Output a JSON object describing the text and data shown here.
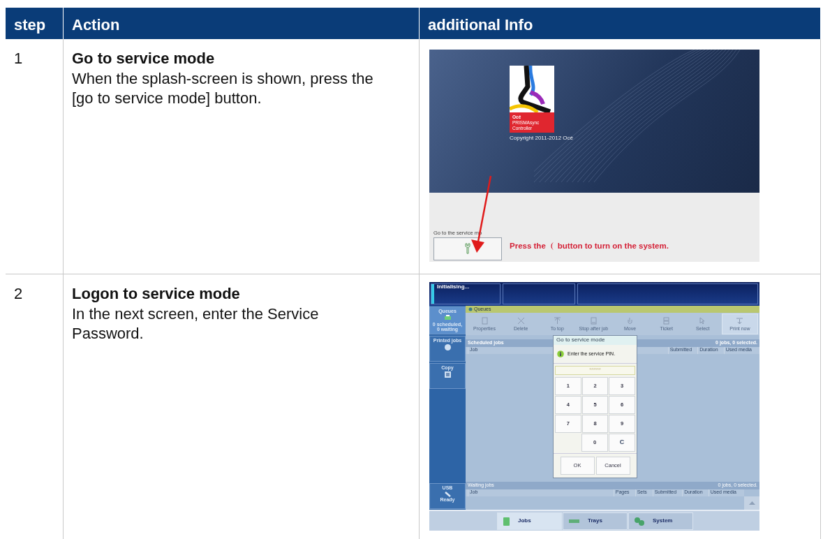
{
  "table": {
    "columns": [
      "step",
      "Action",
      "additional Info"
    ],
    "rows": [
      {
        "step": "1",
        "title": "Go to service mode",
        "text": "When the splash-screen is shown, press the [go to service mode] button.",
        "screenshot": {
          "kind": "splash",
          "logo_lines": [
            "Océ",
            "PRISMAsync",
            "Controller"
          ],
          "copyright": "Copyright 2011-2012 Océ",
          "service_label": "Go to the service mo",
          "message_before": "Press the",
          "message_after": "button to turn on the system."
        }
      },
      {
        "step": "2",
        "title": "Logon to service mode",
        "text": "In the next screen, enter the Service Password.",
        "screenshot": {
          "kind": "pin",
          "status": "Initialising...",
          "sidebar": [
            {
              "label": "Queues",
              "detail": "0 scheduled, 0 waiting",
              "selected": true
            },
            {
              "label": "Printed jobs",
              "selected": false
            },
            {
              "label": "Copy",
              "selected": false
            }
          ],
          "usb": {
            "label": "USB",
            "detail": "Ready"
          },
          "section": "Queues",
          "toolbar": [
            {
              "label": "Properties",
              "highlighted": false
            },
            {
              "label": "Delete",
              "highlighted": false
            },
            {
              "label": "To top",
              "highlighted": false
            },
            {
              "label": "Stop after job",
              "highlighted": false
            },
            {
              "label": "Move",
              "highlighted": false
            },
            {
              "label": "Ticket",
              "highlighted": false
            },
            {
              "label": "Select",
              "highlighted": false
            },
            {
              "label": "Print now",
              "highlighted": true
            }
          ],
          "scheduled": {
            "title": "Scheduled jobs",
            "count": "0 jobs, 0 selected.",
            "columns": [
              "Job",
              "Submitted",
              "Duration",
              "Used media"
            ]
          },
          "dialog": {
            "title": "Go to service mode",
            "message": "Enter the service PIN.",
            "pin": "******",
            "keys": [
              [
                "1",
                "2",
                "3"
              ],
              [
                "4",
                "5",
                "6"
              ],
              [
                "7",
                "8",
                "9"
              ],
              [
                "0",
                "C"
              ]
            ],
            "buttons": [
              "OK",
              "Cancel"
            ]
          },
          "waiting": {
            "title": "Waiting jobs",
            "count": "0 jobs, 0 selected.",
            "columns": [
              "Job",
              "Pages",
              "Sets",
              "Submitted",
              "Duration",
              "Used media"
            ]
          },
          "tabs": [
            {
              "label": "Jobs",
              "selected": true
            },
            {
              "label": "Trays",
              "selected": false
            },
            {
              "label": "System",
              "selected": false
            }
          ]
        }
      }
    ]
  }
}
